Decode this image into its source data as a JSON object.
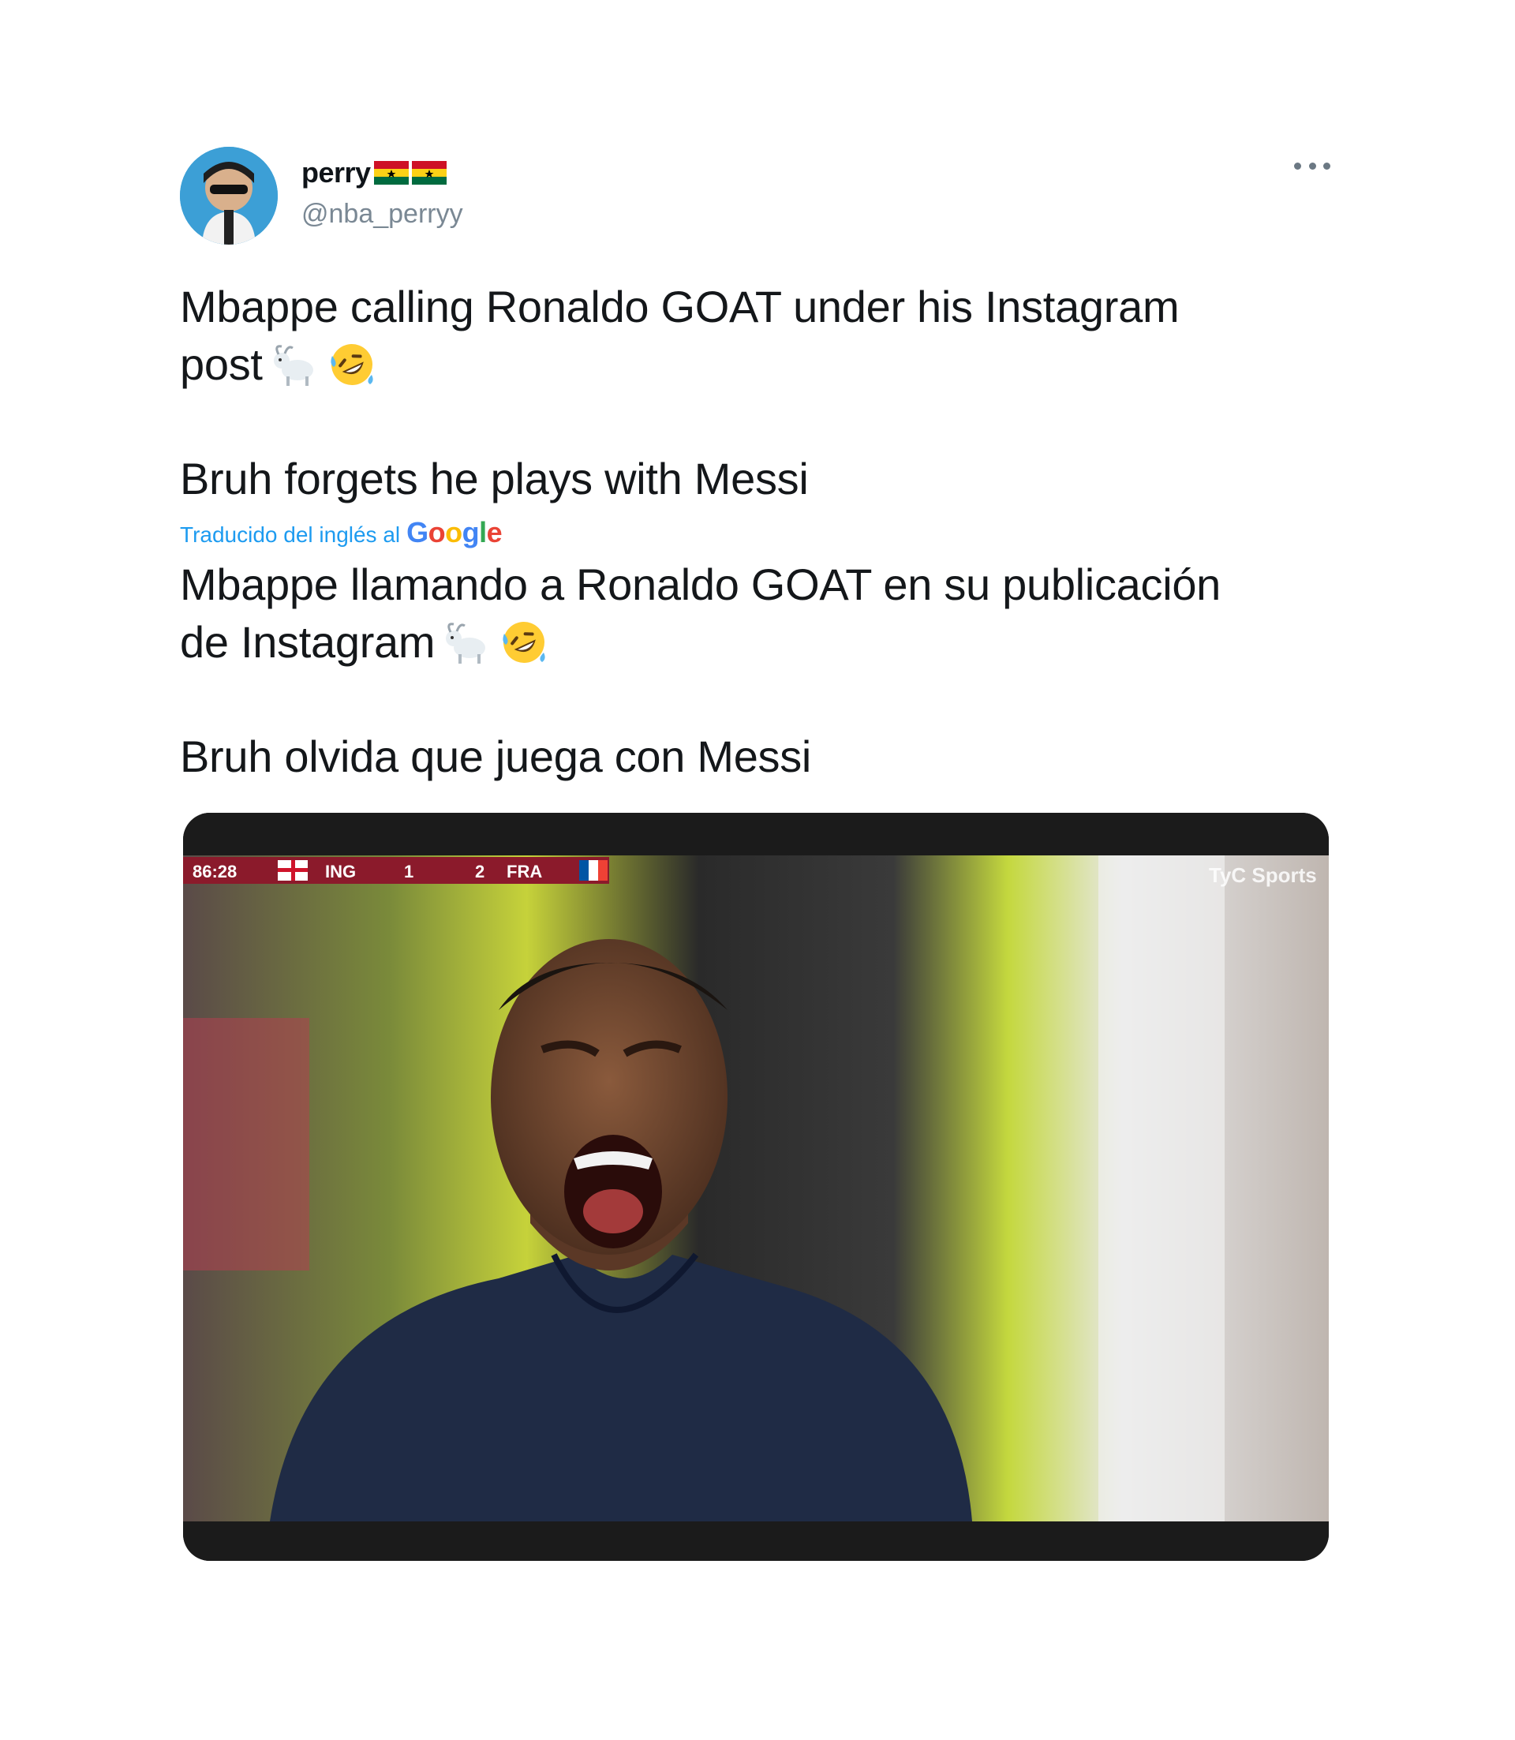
{
  "tweet": {
    "display_name": "perry",
    "name_flags": [
      "ghana-flag-icon",
      "ghana-flag-icon"
    ],
    "handle": "@nba_perryy",
    "original_line1": "Mbappe calling Ronaldo GOAT under his Instagram",
    "original_line2": "post",
    "original_line3": "Bruh forgets he plays with Messi",
    "translation_label": "Traducido del inglés al",
    "translation_provider": "Google",
    "translated_line1": "Mbappe llamando a Ronaldo GOAT en su publicación",
    "translated_line2": "de Instagram",
    "translated_line3": "Bruh olvida que juega con Messi",
    "emojis": [
      "goat-emoji-icon",
      "rolling-laughing-emoji-icon"
    ]
  },
  "media": {
    "scoreboard": {
      "clock": "86:28",
      "home_team": "ING",
      "home_score": "1",
      "away_score": "2",
      "away_team": "FRA"
    },
    "broadcaster": "TyC Sports"
  },
  "colors": {
    "link_blue": "#1d9bf0",
    "handle_gray": "#7a8894",
    "scoreboard_red": "#8b1a2b"
  }
}
